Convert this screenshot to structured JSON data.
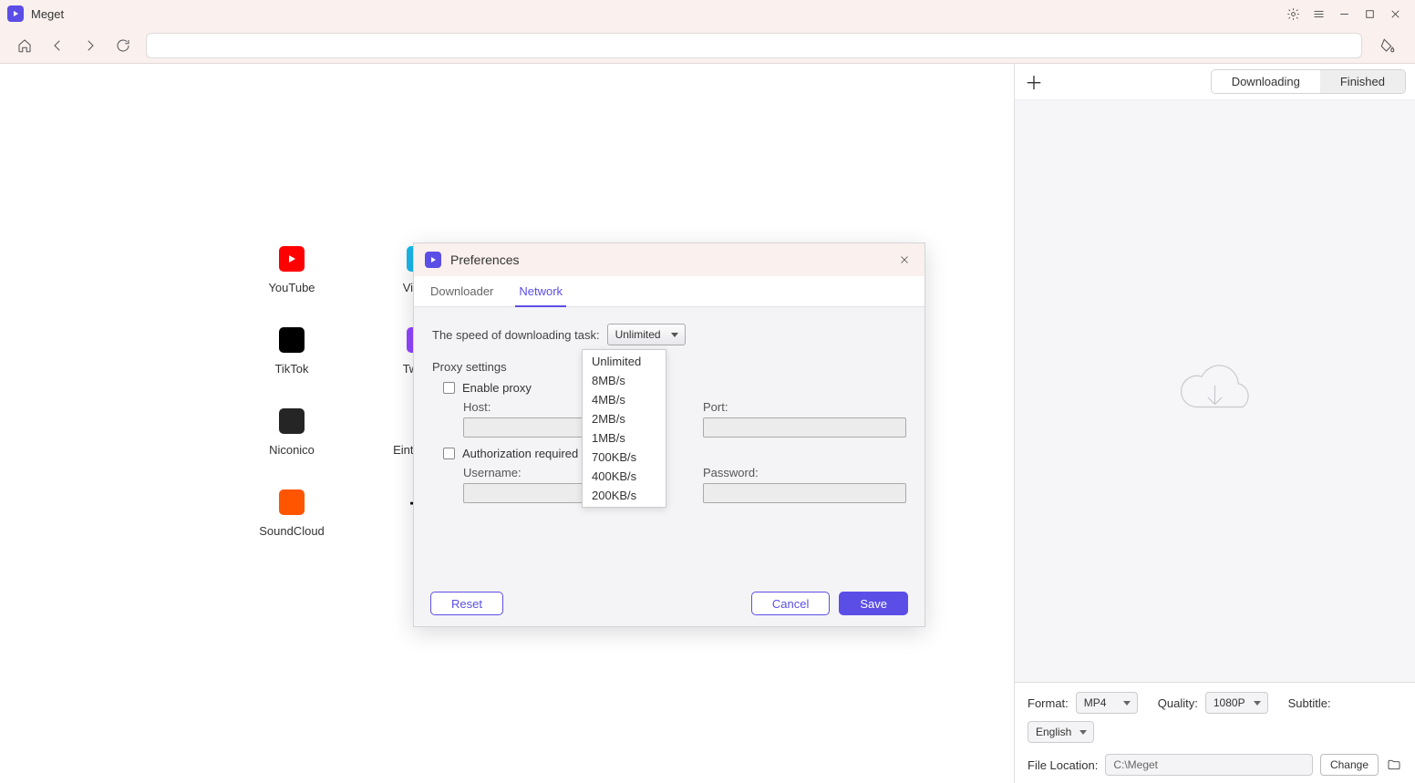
{
  "app": {
    "title": "Meget"
  },
  "sites": [
    {
      "label": "YouTube",
      "cls": "youtube"
    },
    {
      "label": "Vimeo",
      "cls": "vimeo"
    },
    {
      "label": "TikTok",
      "cls": "tiktok"
    },
    {
      "label": "Twitch",
      "cls": "twitch"
    },
    {
      "label": "Niconico",
      "cls": "nico"
    },
    {
      "label": "Einthusan",
      "cls": "eint",
      "glyph": "ℰ"
    },
    {
      "label": "SoundCloud",
      "cls": "sc"
    },
    {
      "label": "",
      "cls": "plus",
      "glyph": "＋"
    }
  ],
  "right_panel": {
    "tab_downloading": "Downloading",
    "tab_finished": "Finished",
    "format_label": "Format:",
    "format_value": "MP4",
    "quality_label": "Quality:",
    "quality_value": "1080P",
    "subtitle_label": "Subtitle:",
    "subtitle_value": "English",
    "file_location_label": "File Location:",
    "file_location_value": "C:\\Meget",
    "change_label": "Change"
  },
  "prefs": {
    "title": "Preferences",
    "tab_downloader": "Downloader",
    "tab_network": "Network",
    "speed_label": "The speed of downloading task:",
    "speed_value": "Unlimited",
    "speed_options": [
      "Unlimited",
      "8MB/s",
      "4MB/s",
      "2MB/s",
      "1MB/s",
      "700KB/s",
      "400KB/s",
      "200KB/s"
    ],
    "proxy_section": "Proxy settings",
    "enable_proxy": "Enable proxy",
    "host_label": "Host:",
    "port_label": "Port:",
    "auth_label": "Authorization required",
    "username_label": "Username:",
    "password_label": "Password:",
    "reset": "Reset",
    "cancel": "Cancel",
    "save": "Save"
  }
}
